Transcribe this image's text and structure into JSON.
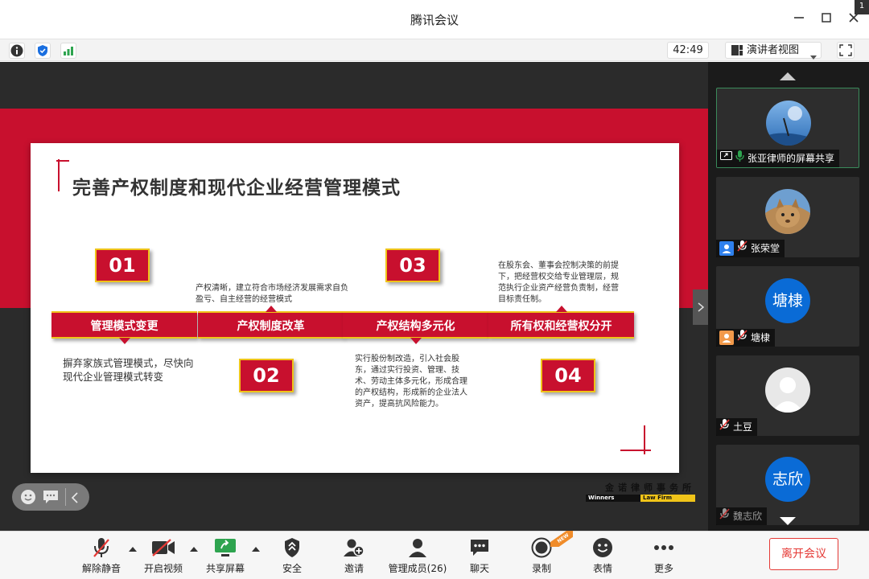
{
  "window": {
    "title": "腾讯会议",
    "corner_label": "1"
  },
  "status_bar": {
    "timer": "42:49",
    "view_mode": "演讲者视图",
    "signal_color": "#2ea44f",
    "shield_color": "#1a6fe0"
  },
  "slide": {
    "title": "完善产权制度和现代企业经营管理模式",
    "steps": [
      {
        "number": "01",
        "label": "管理模式变更",
        "description": "摒弃家族式管理模式，尽快向现代企业管理模式转变"
      },
      {
        "number": "02",
        "label": "产权制度改革",
        "description": "产权清晰，建立符合市场经济发展需求自负盈亏、自主经营的经营模式"
      },
      {
        "number": "03",
        "label": "产权结构多元化",
        "description": "实行股份制改造，引入社会股东，通过实行投资、管理、技术、劳动主体多元化，形成合理的产权结构，形成新的企业法人资产，提高抗风险能力。"
      },
      {
        "number": "04",
        "label": "所有权和经营权分开",
        "description": "在股东会、董事会控制决策的前提下，把经营权交给专业管理层，规范执行企业资产经营负责制，经营目标责任制。"
      }
    ],
    "logo": {
      "cn": "金诺律师事务所",
      "en_left": "Winners",
      "en_right": "Law Firm"
    },
    "accent_color": "#c8102e",
    "border_color": "#f0c419"
  },
  "participants": [
    {
      "name": "张亚律师的屏幕共享",
      "avatar_type": "photo-sky",
      "sharing": true,
      "mic": "on"
    },
    {
      "name": "张荣堂",
      "avatar_type": "photo-cat",
      "mic": "muted"
    },
    {
      "name": "塘棣",
      "avatar_text": "塘棣",
      "avatar_color": "#0a6bd6",
      "mic": "muted"
    },
    {
      "name": "土豆",
      "avatar_type": "default-person",
      "mic": "muted"
    },
    {
      "name": "魏志欣",
      "avatar_text": "志欣",
      "avatar_color": "#0a6bd6",
      "mic": "muted"
    }
  ],
  "toolbar": {
    "unmute": "解除静音",
    "start_video": "开启视频",
    "share_screen": "共享屏幕",
    "security": "安全",
    "invite": "邀请",
    "manage_members": "管理成员(26)",
    "chat": "聊天",
    "record": "录制",
    "reactions": "表情",
    "more": "更多",
    "leave": "离开会议",
    "new_badge": "NEW"
  }
}
